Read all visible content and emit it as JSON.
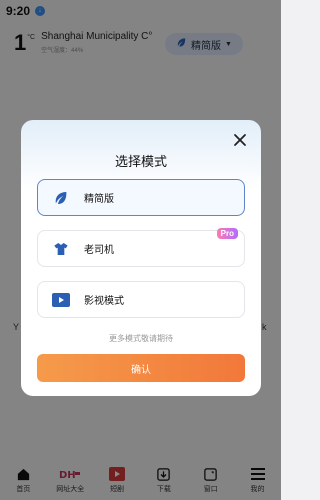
{
  "status_bar": {
    "time": "9:20",
    "notification": "↓"
  },
  "weather": {
    "temperature": "1",
    "unit": "°C",
    "city": "Shanghai Municipality  C°",
    "air_quality": "空气湿度：44%"
  },
  "mode_pill": {
    "label": "精简版",
    "caret": "▼"
  },
  "background_text": {
    "left": "Y",
    "right": "k"
  },
  "modal": {
    "title": "选择模式",
    "options": [
      {
        "label": "精简版",
        "icon": "leaf-icon",
        "selected": true
      },
      {
        "label": "老司机",
        "icon": "shirt-icon",
        "badge": "Pro"
      },
      {
        "label": "影视模式",
        "icon": "play-icon"
      }
    ],
    "hint": "更多模式敬请期待",
    "confirm": "确认"
  },
  "bottom_nav": {
    "items": [
      {
        "label": "首页",
        "icon": "home-icon"
      },
      {
        "label": "网址大全",
        "icon": "dh-logo-icon"
      },
      {
        "label": "短剧",
        "icon": "video-icon"
      },
      {
        "label": "下载",
        "icon": "download-icon"
      },
      {
        "label": "窗口",
        "icon": "window-icon"
      },
      {
        "label": "我的",
        "icon": "menu-icon"
      }
    ]
  },
  "colors": {
    "accent_blue": "#5e86cf",
    "confirm_orange": "#f2783a",
    "pro_pink": "#ff7ab0"
  }
}
